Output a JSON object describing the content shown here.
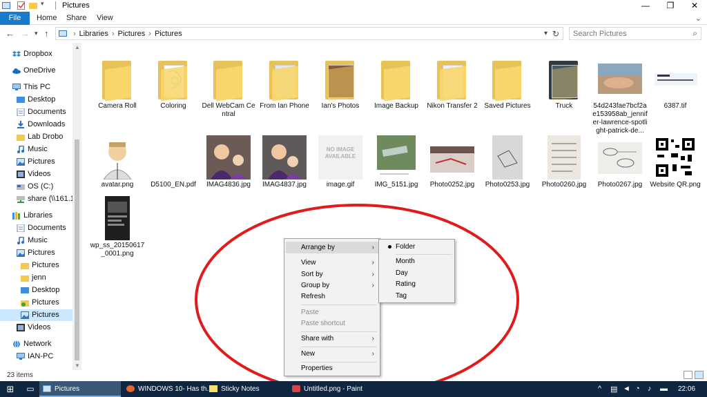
{
  "window": {
    "title": "Pictures",
    "controls": {
      "minimize": "—",
      "maximize": "❐",
      "close": "✕"
    }
  },
  "ribbon": {
    "tabs": [
      "File",
      "Home",
      "Share",
      "View"
    ],
    "help": "?"
  },
  "address": {
    "crumbs": [
      "Libraries",
      "Pictures",
      "Pictures"
    ],
    "search_placeholder": "Search Pictures"
  },
  "nav": {
    "items": [
      {
        "label": "Dropbox",
        "icon": "dropbox-icon"
      },
      {
        "label": "OneDrive",
        "icon": "onedrive-icon"
      },
      {
        "label": "This PC",
        "icon": "pc-icon"
      },
      {
        "label": "Desktop",
        "icon": "desktop-folder-icon"
      },
      {
        "label": "Documents",
        "icon": "documents-icon"
      },
      {
        "label": "Downloads",
        "icon": "downloads-icon"
      },
      {
        "label": "Lab Drobo",
        "icon": "folder-icon"
      },
      {
        "label": "Music",
        "icon": "music-icon"
      },
      {
        "label": "Pictures",
        "icon": "pictures-icon"
      },
      {
        "label": "Videos",
        "icon": "videos-icon"
      },
      {
        "label": "OS (C:)",
        "icon": "drive-icon"
      },
      {
        "label": "share (\\\\161.130.",
        "icon": "network-drive-icon"
      },
      {
        "label": "Libraries",
        "icon": "libraries-icon"
      },
      {
        "label": "Documents",
        "icon": "documents-icon"
      },
      {
        "label": "Music",
        "icon": "music-icon"
      },
      {
        "label": "Pictures",
        "icon": "pictures-icon"
      },
      {
        "label": "Pictures",
        "icon": "folder-icon"
      },
      {
        "label": "jenn",
        "icon": "folder-icon"
      },
      {
        "label": "Desktop",
        "icon": "desktop-folder-icon"
      },
      {
        "label": "Pictures",
        "icon": "pictures-sync-icon"
      },
      {
        "label": "Pictures",
        "icon": "pictures-icon"
      },
      {
        "label": "Videos",
        "icon": "videos-icon"
      },
      {
        "label": "Network",
        "icon": "network-icon"
      },
      {
        "label": "IAN-PC",
        "icon": "pc-icon"
      }
    ]
  },
  "files": {
    "row1": [
      "Camera Roll",
      "Coloring",
      "Dell WebCam Central",
      "From Ian Phone",
      "Ian's Photos",
      "Image Backup",
      "Nikon Transfer 2",
      "Saved Pictures",
      "Truck",
      "54d243fae7bcf2ae153958ab_jennifer-lawrence-spotlight-patrick-de...",
      "6387.tif"
    ],
    "row2": [
      "avatar.png",
      "D5100_EN.pdf",
      "IMAG4836.jpg",
      "IMAG4837.jpg",
      "image.gif",
      "IMG_5151.jpg",
      "Photo0252.jpg",
      "Photo0253.jpg",
      "Photo0260.jpg",
      "Photo0267.jpg",
      "Website QR.png"
    ],
    "row3": [
      "wp_ss_20150617_0001.png"
    ],
    "no_image_text": "NO IMAGE AVAILABLE"
  },
  "status": {
    "count": "23 items"
  },
  "context_menu": {
    "arrange_by": "Arrange by",
    "view": "View",
    "sort_by": "Sort by",
    "group_by": "Group by",
    "refresh": "Refresh",
    "paste": "Paste",
    "paste_shortcut": "Paste shortcut",
    "share_with": "Share with",
    "new": "New",
    "properties": "Properties"
  },
  "submenu": {
    "folder": "Folder",
    "month": "Month",
    "day": "Day",
    "rating": "Rating",
    "tag": "Tag"
  },
  "taskbar": {
    "items": [
      {
        "label": "Pictures",
        "icon": "file-explorer-icon"
      },
      {
        "label": "WINDOWS 10- Has th...",
        "icon": "firefox-icon"
      },
      {
        "label": "Sticky Notes",
        "icon": "sticky-notes-icon"
      },
      {
        "label": "Untitled.png - Paint",
        "icon": "paint-icon"
      }
    ],
    "clock": "22:06"
  },
  "colors": {
    "accent": "#1979ca",
    "taskbar": "#10253f",
    "annotation_ellipse": "#e01b1b",
    "folder": "#f9d66a"
  }
}
